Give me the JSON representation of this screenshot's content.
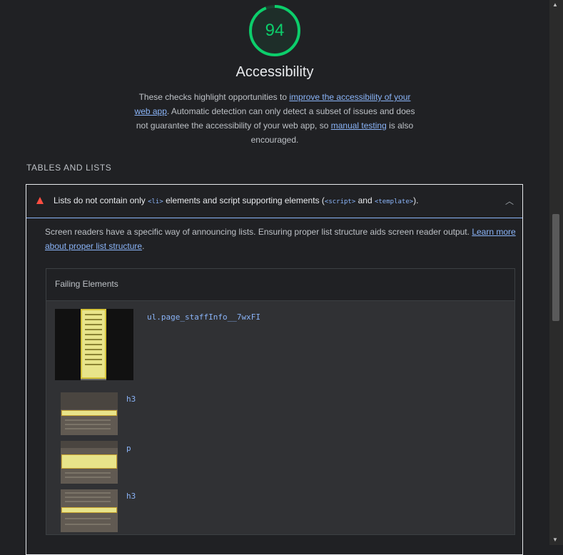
{
  "category": {
    "score": "94",
    "score_fraction": 0.94,
    "score_color": "#0cce6b",
    "title": "Accessibility",
    "description": {
      "part1": "These checks highlight opportunities to ",
      "link1": "improve the accessibility of your web app",
      "part2": ". Automatic detection can only detect a subset of issues and does not guarantee the accessibility of your web app, so ",
      "link2": "manual testing",
      "part3": " is also encouraged."
    }
  },
  "group": {
    "title": "TABLES AND LISTS"
  },
  "audit": {
    "status_icon": "fail-triangle-icon",
    "title_prefix": "Lists do not contain only ",
    "code_li": "<li>",
    "title_middle": " elements and script supporting elements (",
    "code_script": "<script>",
    "title_and": " and ",
    "code_template": "<template>",
    "title_suffix": ").",
    "expand_icon": "chevron-up-icon",
    "body_text": "Screen readers have a specific way of announcing lists. Ensuring proper list structure aids screen reader output. ",
    "body_link": "Learn more about proper list structure",
    "body_end": ".",
    "failing_header": "Failing Elements",
    "elements": [
      {
        "selector": "ul.page_staffInfo__7wxFI"
      },
      {
        "selector": "h3"
      },
      {
        "selector": "p"
      },
      {
        "selector": "h3"
      }
    ]
  },
  "colors": {
    "accent_link": "#8ab4f8",
    "fail": "#ff4e42",
    "pass": "#0cce6b"
  }
}
